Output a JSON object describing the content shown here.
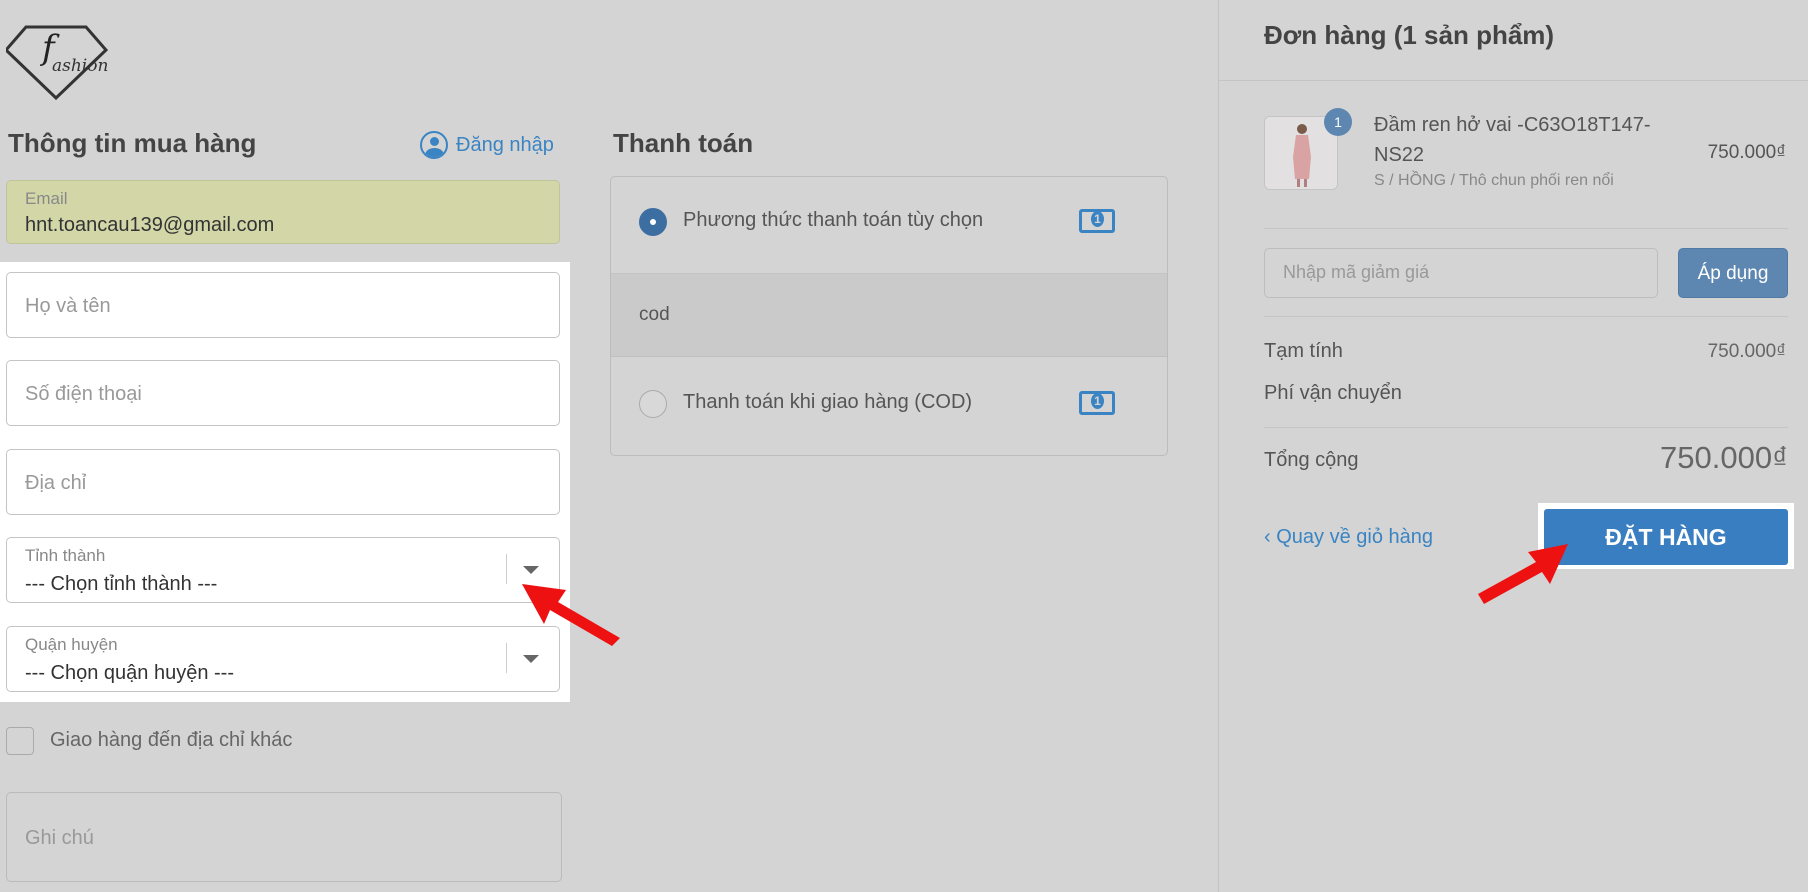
{
  "logo": {
    "initial": "f",
    "text": "ashion"
  },
  "customer": {
    "title": "Thông tin mua hàng",
    "login_label": "Đăng nhập",
    "email_label": "Email",
    "email_value": "hnt.toancau139@gmail.com",
    "name_placeholder": "Họ và tên",
    "phone_placeholder": "Số điện thoại",
    "address_placeholder": "Địa chỉ",
    "province_label": "Tỉnh thành",
    "province_value": "--- Chọn tỉnh thành ---",
    "district_label": "Quận huyện",
    "district_value": "--- Chọn quận huyện ---",
    "other_address_label": "Giao hàng đến địa chỉ khác",
    "note_placeholder": "Ghi chú"
  },
  "payment": {
    "title": "Thanh toán",
    "option1_label": "Phương thức thanh toán tùy chọn",
    "option1_detail": "cod",
    "option2_label": "Thanh toán khi giao hàng (COD)"
  },
  "order": {
    "title": "Đơn hàng (1 sản phẩm)",
    "item": {
      "quantity": "1",
      "name": "Đầm ren hở vai -C63O18T147-NS22",
      "variant": "S / HỒNG / Thô chun phối ren nổi",
      "price": "750.000₫"
    },
    "coupon_placeholder": "Nhập mã giảm giá",
    "apply_label": "Áp dụng",
    "subtotal_label": "Tạm tính",
    "subtotal_value": "750.000₫",
    "shipping_label": "Phí vận chuyển",
    "total_label": "Tổng cộng",
    "total_value": "750.000₫",
    "back_label": "Quay về giỏ hàng",
    "order_button": "ĐẶT HÀNG"
  },
  "colors": {
    "accent": "#3a7ec2",
    "annotation": "#f01010",
    "background": "#d4d4d4"
  }
}
